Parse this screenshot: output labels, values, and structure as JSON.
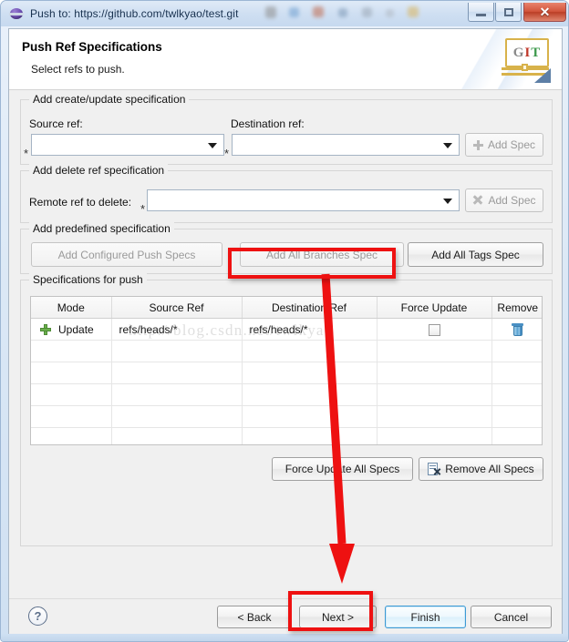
{
  "window": {
    "title": "Push to: https://github.com/twlkyao/test.git",
    "icon": "globe-icon",
    "controls": {
      "minimize": "–",
      "maximize": "□",
      "close": "✕"
    }
  },
  "header": {
    "title": "Push Ref Specifications",
    "subtitle": "Select refs to push.",
    "logo": {
      "g": "G",
      "i": "I",
      "t": "T"
    }
  },
  "groups": {
    "create_update": {
      "legend": "Add create/update specification",
      "source_label": "Source ref:",
      "destination_label": "Destination ref:",
      "source_value": "",
      "destination_value": "",
      "required_marker": "*",
      "add_spec_button": "Add Spec"
    },
    "delete_ref": {
      "legend": "Add delete ref specification",
      "remote_label": "Remote ref to delete:",
      "remote_value": "",
      "required_marker": "*",
      "add_spec_button": "Add Spec"
    },
    "predefined": {
      "legend": "Add predefined specification",
      "add_configured_push_specs": "Add Configured Push Specs",
      "add_all_branches_spec": "Add All Branches Spec",
      "add_all_tags_spec": "Add All Tags Spec"
    },
    "specs_for_push": {
      "legend": "Specifications for push",
      "columns": [
        "Mode",
        "Source Ref",
        "Destination Ref",
        "Force Update",
        "Remove"
      ],
      "rows": [
        {
          "mode": "Update",
          "source_ref": "refs/heads/*",
          "destination_ref": "refs/heads/*",
          "force_update": false,
          "remove_icon": "trash-icon"
        }
      ],
      "empty_row_count": 5,
      "force_update_all_button": "Force Update All Specs",
      "remove_all_button": "Remove All Specs"
    }
  },
  "watermark": "http://blog.csdn.net/twlkyao",
  "footer": {
    "help": "?",
    "back": "< Back",
    "next": "Next >",
    "finish": "Finish",
    "cancel": "Cancel"
  },
  "annotations": {
    "highlight_color": "#ee1111",
    "boxes": [
      "add-all-branches-spec",
      "next-button"
    ],
    "arrow": "from add-all-branches-spec down to next-button"
  }
}
